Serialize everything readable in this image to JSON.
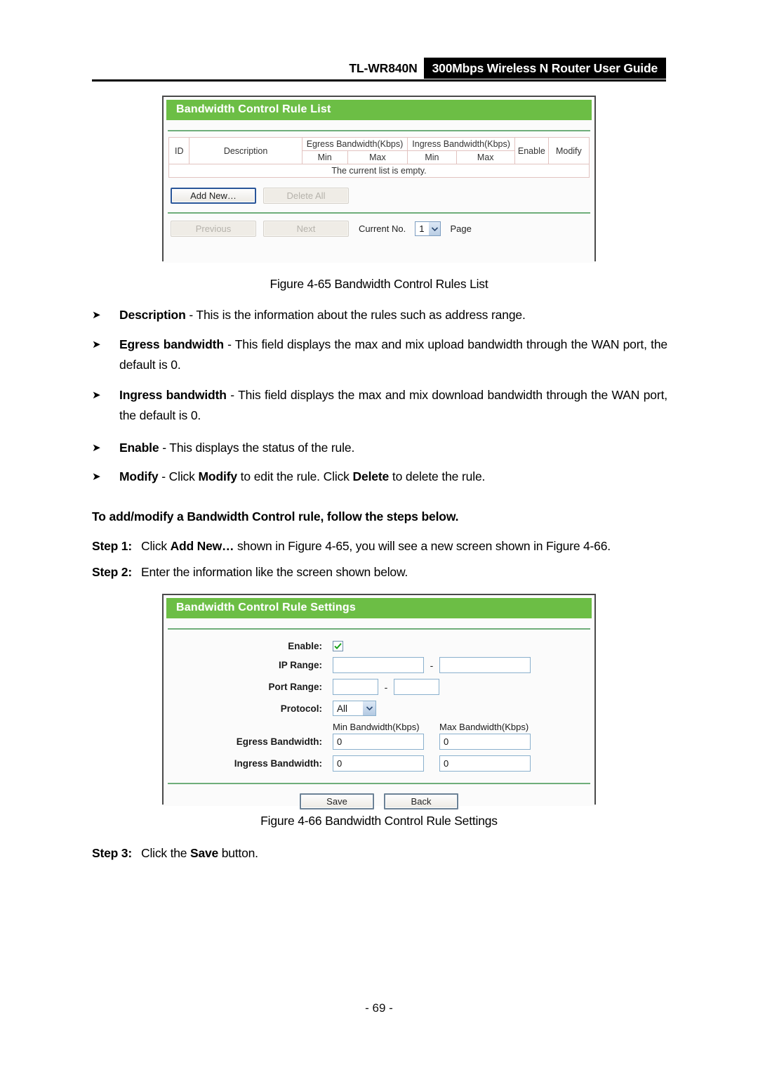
{
  "header": {
    "model": "TL-WR840N",
    "title": "300Mbps Wireless N Router User Guide"
  },
  "figure_rule_list": {
    "panel_title": "Bandwidth Control Rule List",
    "table": {
      "col_id": "ID",
      "col_description": "Description",
      "col_egress": "Egress Bandwidth(Kbps)",
      "col_ingress": "Ingress Bandwidth(Kbps)",
      "col_enable": "Enable",
      "col_modify": "Modify",
      "sub_egress_min": "Min",
      "sub_egress_max": "Max",
      "sub_ingress_min": "Min",
      "sub_ingress_max": "Max",
      "empty_message": "The current list is empty."
    },
    "buttons": {
      "add_new": "Add New…",
      "delete_all": "Delete All",
      "previous": "Previous",
      "next": "Next"
    },
    "pager": {
      "prefix": "Current No.",
      "value": "1",
      "suffix": "Page"
    },
    "caption": "Figure 4-65 Bandwidth Control Rules List"
  },
  "bullets": [
    {
      "term": "Description",
      "dash": " - ",
      "text": "This is the information about the rules such as address range."
    },
    {
      "term": "Egress bandwidth",
      "dash": " - ",
      "text": "This field displays the max and mix upload bandwidth through the WAN port, the default is 0."
    },
    {
      "term": "Ingress bandwidth",
      "dash": " - ",
      "text": "This field displays the max and mix download bandwidth through the WAN port, the default is 0."
    },
    {
      "term": "Enable",
      "dash": " - ",
      "text": "This displays the status of the rule."
    },
    {
      "term": "Modify",
      "dash": " - ",
      "text": "Click Modify to edit the rule. Click Delete to delete the rule."
    }
  ],
  "intro_paragraph": "To add/modify a Bandwidth Control rule, follow the steps below.",
  "steps": [
    {
      "label": "Step 1:",
      "text": "Click Add New… shown in Figure 4-65, you will see a new screen shown in Figure 4-66."
    },
    {
      "label": "Step 2:",
      "text": "Enter the information like the screen shown below."
    },
    {
      "label": "Step 3:",
      "text": "Click the Save button."
    }
  ],
  "figure_rule_settings": {
    "panel_title": "Bandwidth Control Rule Settings",
    "labels": {
      "enable": "Enable:",
      "ip_range": "IP Range:",
      "port_range": "Port Range:",
      "protocol": "Protocol:",
      "egress_bandwidth": "Egress Bandwidth:",
      "ingress_bandwidth": "Ingress Bandwidth:",
      "min_bandwidth": "Min Bandwidth(Kbps)",
      "max_bandwidth": "Max Bandwidth(Kbps)"
    },
    "values": {
      "enable_checked": "checked",
      "ip_start": "",
      "ip_end": "",
      "port_start": "",
      "port_end": "",
      "protocol": "All",
      "egress_min": "0",
      "egress_max": "0",
      "ingress_min": "0",
      "ingress_max": "0",
      "range_separator": "-"
    },
    "buttons": {
      "save": "Save",
      "back": "Back"
    },
    "caption": "Figure 4-66 Bandwidth Control Rule Settings"
  },
  "footer": {
    "page_number": "- 69 -"
  },
  "colors": {
    "panel_green": "#6cbe45",
    "separator_green": "#6fae7a",
    "table_border_pink": "#e2c3c0",
    "header_black": "#000000"
  }
}
